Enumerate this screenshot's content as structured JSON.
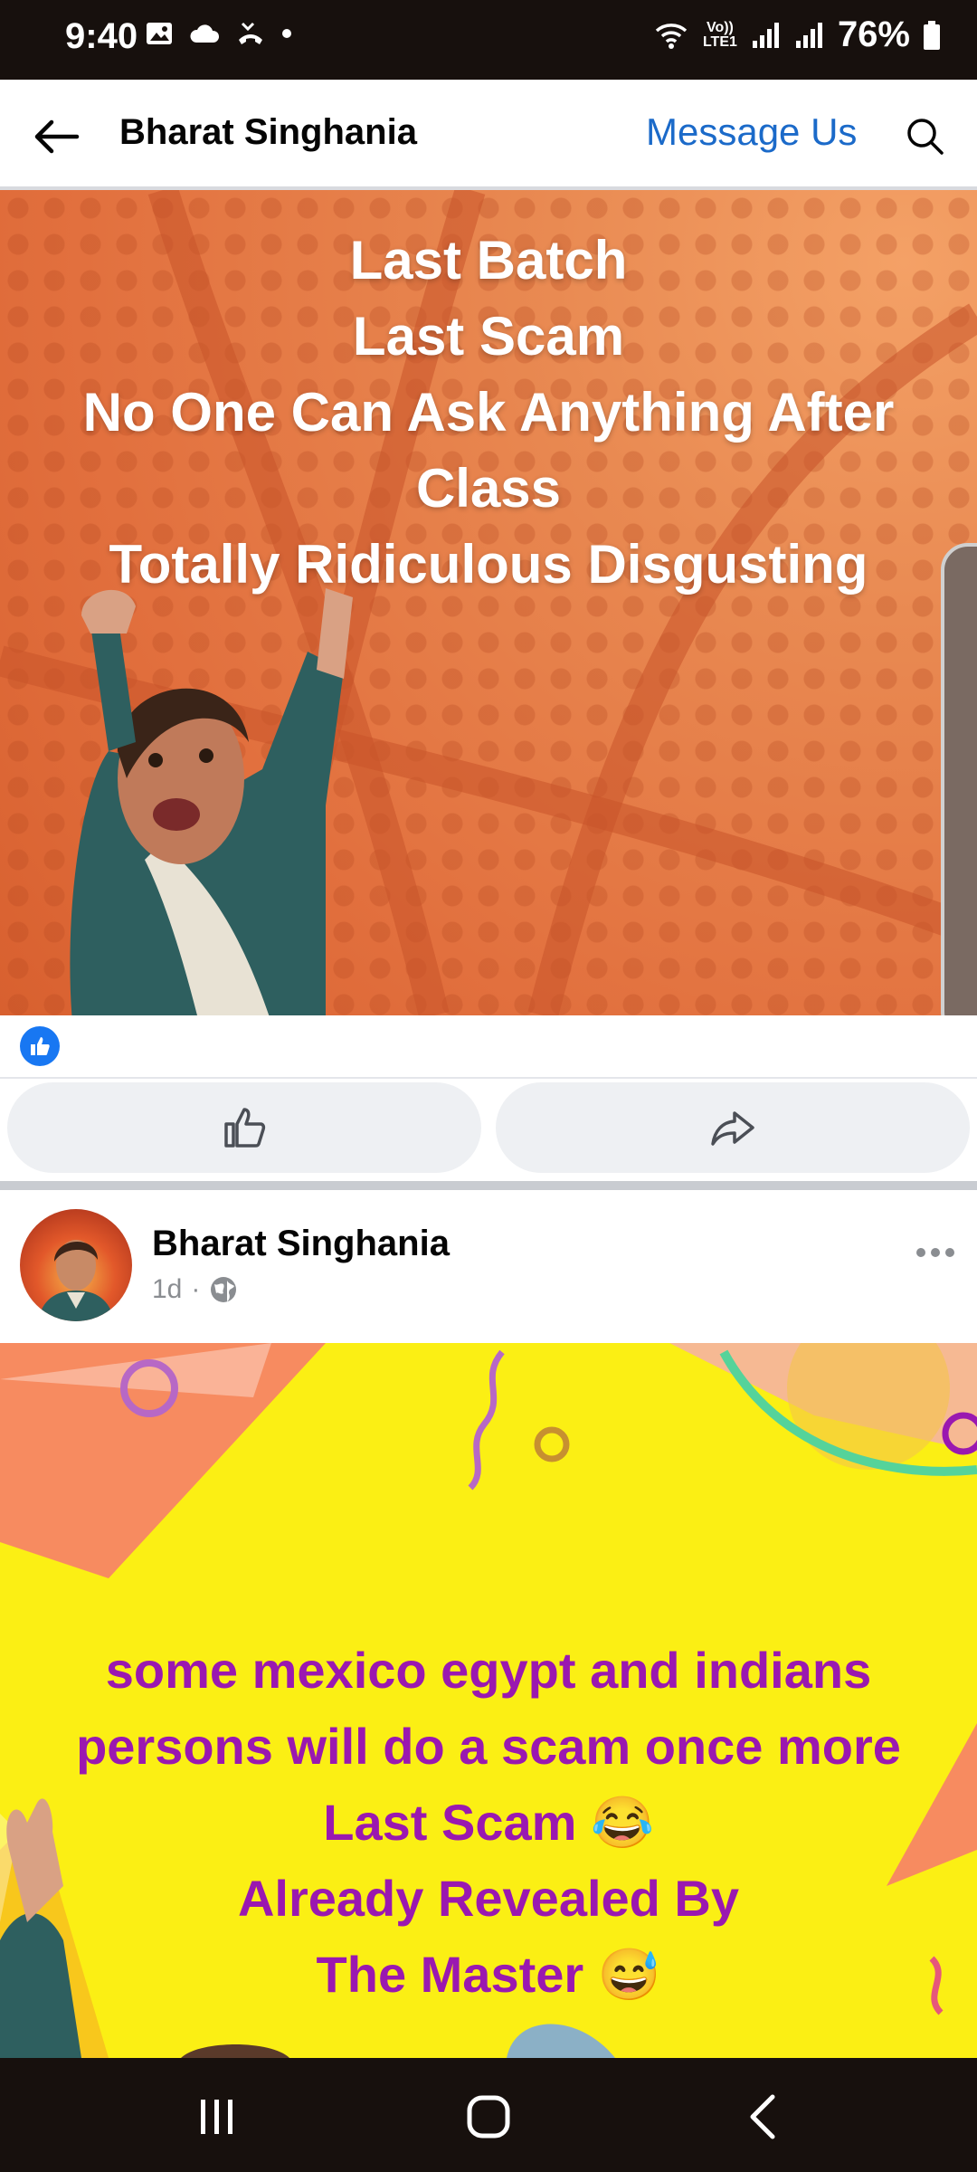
{
  "status_bar": {
    "time": "9:40",
    "network_label": "Vo)) LTE1",
    "battery": "76%"
  },
  "header": {
    "title": "Bharat Singhania",
    "message_button": "Message Us"
  },
  "post1": {
    "image_text": [
      "Last Batch",
      "Last Scam",
      "No One Can Ask Anything After Class",
      "Totally Ridiculous Disgusting"
    ],
    "reaction_icon": "like-icon",
    "actions": [
      "like-icon",
      "share-icon"
    ]
  },
  "post2": {
    "author": "Bharat Singhania",
    "time": "1d",
    "separator": "·",
    "privacy_icon": "globe-icon",
    "image_text": [
      "some mexico egypt and indians persons will do a scam once more",
      "Last Scam 😂",
      "Already Revealed By",
      "The Master 😅"
    ]
  },
  "colors": {
    "accent": "#1b6ac9",
    "post2_text": "#9a18b0",
    "post2_bg": "#fbef14"
  }
}
